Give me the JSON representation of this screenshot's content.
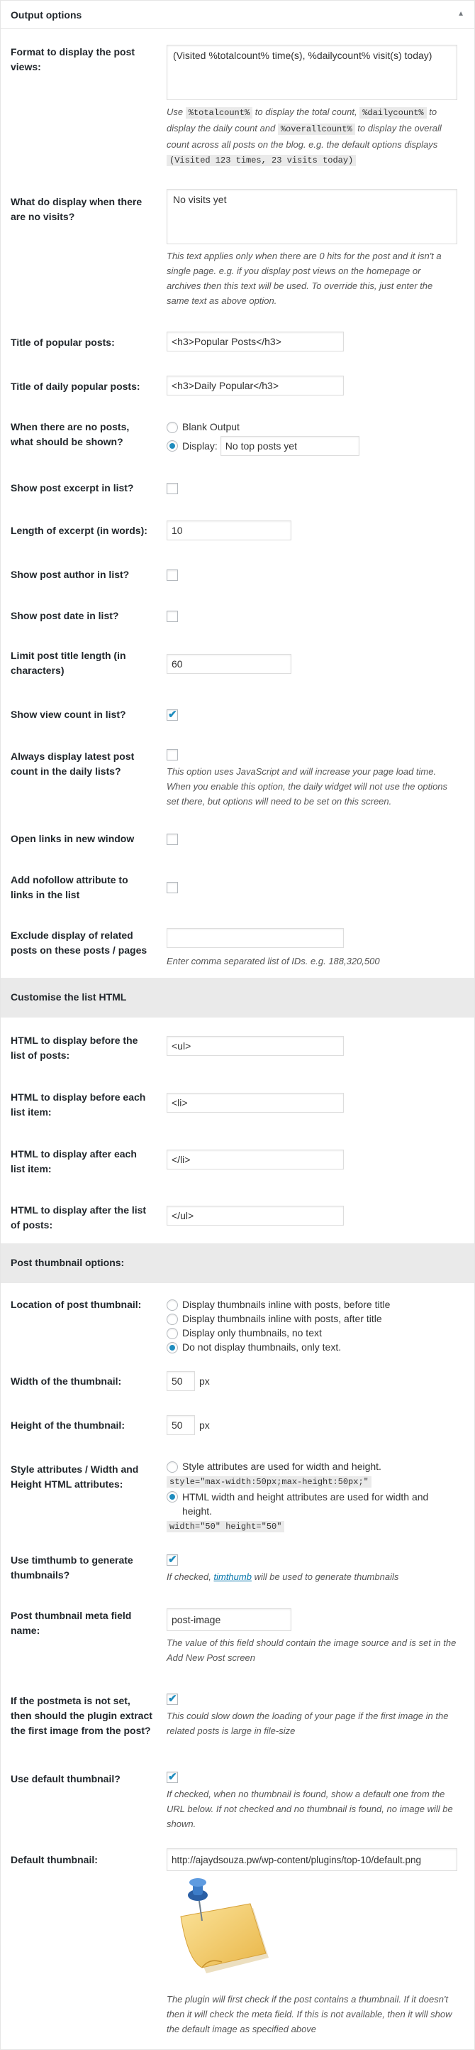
{
  "panel": {
    "title": "Output options"
  },
  "rows": {
    "format": {
      "label": "Format to display the post views:",
      "value": "(Visited %totalcount% time(s), %dailycount% visit(s) today)",
      "desc": {
        "p1": "Use ",
        "c1": "%totalcount%",
        "p2": " to display the total count, ",
        "c2": "%dailycount%",
        "p3": " to display the daily count and ",
        "c3": "%overallcount%",
        "p4": " to display the overall count across all posts on the blog. e.g. the default options displays ",
        "c4": "(Visited 123 times, 23 visits today)"
      }
    },
    "novisits": {
      "label": "What do display when there are no visits?",
      "value": "No visits yet",
      "desc": "This text applies only when there are 0 hits for the post and it isn't a single page. e.g. if you display post views on the homepage or archives then this text will be used. To override this, just enter the same text as above option."
    },
    "popular_title": {
      "label": "Title of popular posts:",
      "value": "<h3>Popular Posts</h3>"
    },
    "daily_title": {
      "label": "Title of daily popular posts:",
      "value": "<h3>Daily Popular</h3>"
    },
    "noposts": {
      "label": "When there are no posts, what should be shown?",
      "opt1": "Blank Output",
      "opt2": "Display:",
      "value": "No top posts yet"
    },
    "excerpt": {
      "label": "Show post excerpt in list?"
    },
    "excerpt_len": {
      "label": "Length of excerpt (in words):",
      "value": "10"
    },
    "author": {
      "label": "Show post author in list?"
    },
    "date": {
      "label": "Show post date in list?"
    },
    "title_len": {
      "label": "Limit post title length (in characters)",
      "value": "60"
    },
    "viewcount": {
      "label": "Show view count in list?"
    },
    "latest": {
      "label": "Always display latest post count in the daily lists?",
      "desc": "This option uses JavaScript and will increase your page load time. When you enable this option, the daily widget will not use the options set there, but options will need to be set on this screen."
    },
    "newwindow": {
      "label": "Open links in new window"
    },
    "nofollow": {
      "label": "Add nofollow attribute to links in the list"
    },
    "exclude": {
      "label": "Exclude display of related posts on these posts / pages",
      "value": "",
      "desc": "Enter comma separated list of IDs. e.g. 188,320,500"
    }
  },
  "section_html": {
    "title": "Customise the list HTML"
  },
  "html_rows": {
    "before_list": {
      "label": "HTML to display before the list of posts:",
      "value": "<ul>"
    },
    "before_item": {
      "label": "HTML to display before each list item:",
      "value": "<li>"
    },
    "after_item": {
      "label": "HTML to display after each list item:",
      "value": "</li>"
    },
    "after_list": {
      "label": "HTML to display after the list of posts:",
      "value": "</ul>"
    }
  },
  "section_thumb": {
    "title": "Post thumbnail options:"
  },
  "thumb_rows": {
    "location": {
      "label": "Location of post thumbnail:",
      "opts": [
        "Display thumbnails inline with posts, before title",
        "Display thumbnails inline with posts, after title",
        "Display only thumbnails, no text",
        "Do not display thumbnails, only text."
      ]
    },
    "width": {
      "label": "Width of the thumbnail:",
      "value": "50",
      "unit": "px"
    },
    "height": {
      "label": "Height of the thumbnail:",
      "value": "50",
      "unit": "px"
    },
    "style": {
      "label": "Style attributes / Width and Height HTML attributes:",
      "opt1": "Style attributes are used for width and height.",
      "code1": "style=\"max-width:50px;max-height:50px;\"",
      "opt2": "HTML width and height attributes are used for width and height.",
      "code2": "width=\"50\" height=\"50\""
    },
    "timthumb": {
      "label": "Use timthumb to generate thumbnails?",
      "d1": "If checked, ",
      "link": "timthumb",
      "d2": " will be used to generate thumbnails"
    },
    "meta": {
      "label": "Post thumbnail meta field name:",
      "value": "post-image",
      "desc": "The value of this field should contain the image source and is set in the Add New Post screen"
    },
    "extract": {
      "label": "If the postmeta is not set, then should the plugin extract the first image from the post?",
      "desc": "This could slow down the loading of your page if the first image in the related posts is large in file-size"
    },
    "default_thumb": {
      "label": "Use default thumbnail?",
      "desc": "If checked, when no thumbnail is found, show a default one from the URL below. If not checked and no thumbnail is found, no image will be shown."
    },
    "default_url": {
      "label": "Default thumbnail:",
      "value": "http://ajaydsouza.pw/wp-content/plugins/top-10/default.png",
      "desc": "The plugin will first check if the post contains a thumbnail. If it doesn't then it will check the meta field. If this is not available, then it will show the default image as specified above"
    }
  },
  "colors": {
    "accent": "#1e8cbe",
    "link": "#0073aa",
    "section_bg": "#eaeaea"
  },
  "icons": {
    "toggle": "triangle-up-icon",
    "thumbnail": "pushpin-note-icon"
  }
}
